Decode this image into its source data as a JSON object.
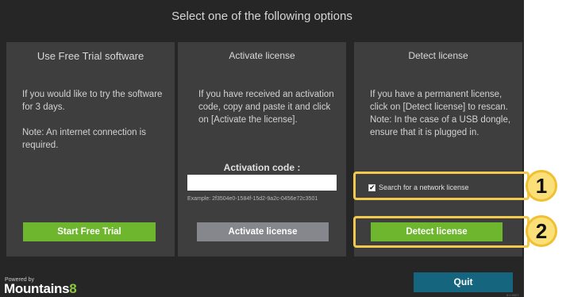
{
  "window": {
    "title": "Select one of the following options"
  },
  "trial": {
    "title": "Use Free Trial software",
    "text": "If you would like to try the software for 3 days.",
    "note": "Note: An internet connection is required.",
    "button_label": "Start Free Trial"
  },
  "activate": {
    "title": "Activate license",
    "text": "If you have received an activation code, copy and paste it and click on [Activate the license].",
    "code_label": "Activation code :",
    "code_value": "",
    "code_example": "Example: 2f3504e0-1584f-15d2-9a2c-0456e72c3501",
    "button_label": "Activate license"
  },
  "detect": {
    "title": "Detect license",
    "text": "If you have a permanent license, click on [Detect license] to rescan.",
    "note": "Note: In the case of a USB dongle, ensure that it is plugged in.",
    "checkbox_label": "Search for a network license",
    "checkbox_checked": true,
    "button_label": "Detect license"
  },
  "callouts": [
    {
      "number": "1"
    },
    {
      "number": "2"
    }
  ],
  "footer": {
    "powered_by": "Powered by",
    "brand_name": "Mountains",
    "brand_version": "8",
    "quit_label": "Quit",
    "version": "8.0.9007"
  },
  "colors": {
    "background": "#262626",
    "card": "#3e3e3e",
    "green_button": "#6fb62f",
    "grey_button": "#85878c",
    "quit_button": "#16657e",
    "callout": "#f2c94c"
  }
}
